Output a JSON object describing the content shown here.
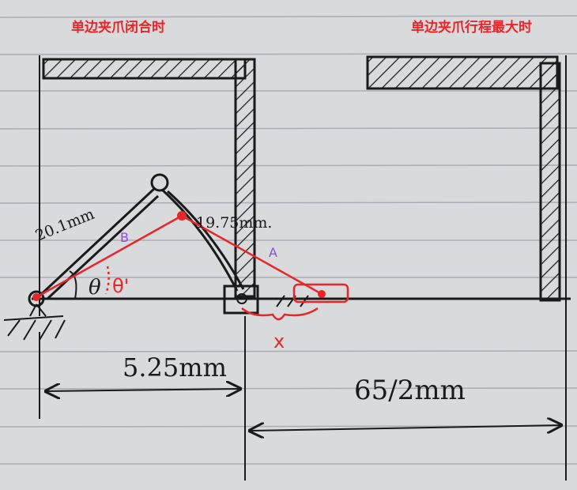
{
  "captions": {
    "closed": "单边夹爪闭合时",
    "max_travel": "单边夹爪行程最大时"
  },
  "labels": {
    "link_b_length": "20.1mm",
    "link_a_length": "19.75mm.",
    "link_b": "B",
    "link_a": "A",
    "theta": "θ",
    "theta_prime": "θ'",
    "x": "x"
  },
  "dimensions": {
    "closed_width": "5.25mm",
    "half_stroke": "65/2mm"
  },
  "colors": {
    "ink": "#1a1a1a",
    "red": "#e8262a",
    "purple": "#8a4fd6",
    "paper": "#d9dadc",
    "rule_line": "#a9adb5"
  }
}
